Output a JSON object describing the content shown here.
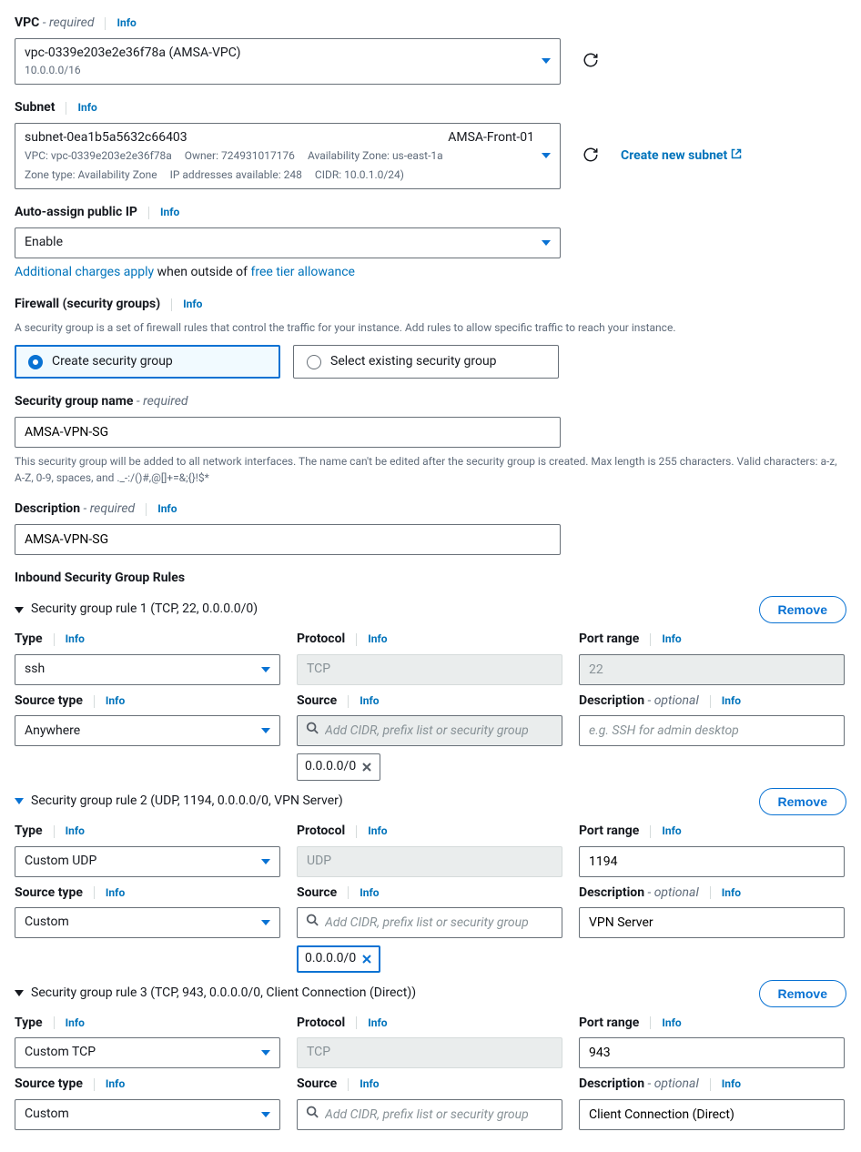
{
  "common": {
    "info": "Info",
    "required": "required",
    "optional": "optional",
    "remove": "Remove"
  },
  "vpc": {
    "label": "VPC",
    "value": "vpc-0339e203e2e36f78a (AMSA-VPC)",
    "cidr": "10.0.0.0/16"
  },
  "subnet": {
    "label": "Subnet",
    "id": "subnet-0ea1b5a5632c66403",
    "name": "AMSA-Front-01",
    "meta_vpc": "VPC: vpc-0339e203e2e36f78a",
    "meta_owner": "Owner: 724931017176",
    "meta_az": "Availability Zone: us-east-1a",
    "meta_zone_type": "Zone type: Availability Zone",
    "meta_ips": "IP addresses available: 248",
    "meta_cidr": "CIDR: 10.0.1.0/24)",
    "create_link": "Create new subnet"
  },
  "auto_ip": {
    "label": "Auto-assign public IP",
    "value": "Enable",
    "charges_pre": "Additional charges apply",
    "charges_mid": " when outside of ",
    "charges_link": "free tier allowance"
  },
  "firewall": {
    "label": "Firewall (security groups)",
    "desc": "A security group is a set of firewall rules that control the traffic for your instance. Add rules to allow specific traffic to reach your instance.",
    "opt_create": "Create security group",
    "opt_existing": "Select existing security group"
  },
  "sg_name": {
    "label": "Security group name",
    "value": "AMSA-VPN-SG",
    "help": "This security group will be added to all network interfaces. The name can't be edited after the security group is created. Max length is 255 characters. Valid characters: a-z, A-Z, 0-9, spaces, and ._-:/()#,@[]+=&;{}!$*"
  },
  "sg_desc": {
    "label": "Description",
    "value": "AMSA-VPN-SG"
  },
  "inbound": {
    "title": "Inbound Security Group Rules",
    "labels": {
      "type": "Type",
      "protocol": "Protocol",
      "port_range": "Port range",
      "source_type": "Source type",
      "source": "Source",
      "description": "Description",
      "source_placeholder": "Add CIDR, prefix list or security group",
      "desc_placeholder": "e.g. SSH for admin desktop"
    },
    "rules": [
      {
        "summary": "Security group rule 1 (TCP, 22, 0.0.0.0/0)",
        "type": "ssh",
        "protocol": "TCP",
        "port": "22",
        "port_disabled": true,
        "source_type": "Anywhere",
        "source_chip": "0.0.0.0/0",
        "source_disabled": true,
        "chip_selected": false,
        "description": ""
      },
      {
        "summary": "Security group rule 2 (UDP, 1194, 0.0.0.0/0, VPN Server)",
        "type": "Custom UDP",
        "protocol": "UDP",
        "port": "1194",
        "port_disabled": false,
        "source_type": "Custom",
        "source_chip": "0.0.0.0/0",
        "source_disabled": false,
        "chip_selected": true,
        "description": "VPN Server"
      },
      {
        "summary": "Security group rule 3 (TCP, 943, 0.0.0.0/0, Client Connection (Direct))",
        "type": "Custom TCP",
        "protocol": "TCP",
        "port": "943",
        "port_disabled": false,
        "source_type": "Custom",
        "source_chip": "",
        "source_disabled": false,
        "chip_selected": false,
        "description": "Client Connection (Direct)"
      }
    ]
  }
}
